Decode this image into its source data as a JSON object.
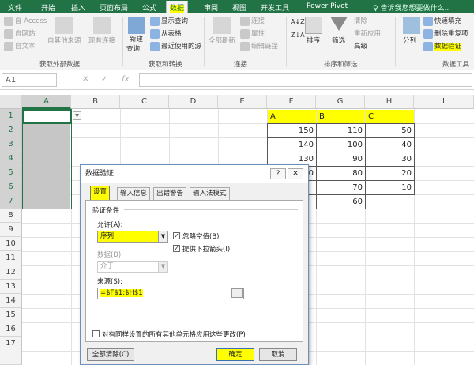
{
  "tabs": [
    "文件",
    "开始",
    "插入",
    "页面布局",
    "公式",
    "数据",
    "审阅",
    "视图",
    "开发工具",
    "Power Pivot"
  ],
  "tab_search": "♀ 告诉我您想要做什么...",
  "ribbon": {
    "external": {
      "access": "自 Access",
      "web": "自网站",
      "text": "自文本",
      "other": "自其他来源",
      "existing": "现有连接",
      "group": "获取外部数据"
    },
    "transform": {
      "new_query": "新建",
      "new_query2": "查询",
      "show_query": "显示查询",
      "from_table": "从表格",
      "recent": "最近使用的源",
      "group": "获取和转换"
    },
    "connections": {
      "refresh_all": "全部刷新",
      "conn": "连接",
      "props": "属性",
      "edit_links": "编辑链接",
      "group": "连接"
    },
    "sort": {
      "az": "A↓Z",
      "za": "Z↓A",
      "sort": "排序",
      "filter": "筛选",
      "clear": "清除",
      "reapply": "重新应用",
      "advanced": "高级",
      "group": "排序和筛选"
    },
    "tools": {
      "split": "分列",
      "flash": "快速填充",
      "remove_dup": "删除重复项",
      "validation": "数据验证",
      "group": "数据工具"
    }
  },
  "formula_bar": {
    "name_box": "A1",
    "cancel": "✕",
    "enter": "✓",
    "fx": "fx"
  },
  "columns": [
    "A",
    "B",
    "C",
    "D",
    "E",
    "F",
    "G",
    "H",
    "I"
  ],
  "rows": [
    "1",
    "2",
    "3",
    "4",
    "5",
    "6",
    "7",
    "8",
    "9",
    "10",
    "11",
    "12",
    "13",
    "14",
    "15",
    "16",
    "17"
  ],
  "cells": {
    "F1": "A",
    "G1": "B",
    "H1": "C",
    "F2": "150",
    "G2": "110",
    "H2": "50",
    "F3": "140",
    "G3": "100",
    "H3": "40",
    "F4": "130",
    "G4": "90",
    "H4": "30",
    "F5": "0",
    "G5": "80",
    "H5": "20",
    "G6": "70",
    "H6": "10",
    "G7": "60"
  },
  "colors": {
    "excel_green": "#217346",
    "highlight": "#ffff00",
    "selection": "#c6c6c6"
  },
  "dialog": {
    "title": "数据验证",
    "help": "?",
    "close": "✕",
    "tabs": [
      "设置",
      "输入信息",
      "出错警告",
      "输入法模式"
    ],
    "criteria": "验证条件",
    "allow_label": "允许(A):",
    "allow_value": "序列",
    "ignore_blank": "忽略空值(B)",
    "dropdown": "提供下拉箭头(I)",
    "data_label": "数据(D):",
    "data_value": "介于",
    "source_label": "来源(S):",
    "source_value": "=$F$1:$H$1",
    "apply_all": "对有同样设置的所有其他单元格应用这些更改(P)",
    "clear_all": "全部清除(C)",
    "ok": "确定",
    "cancel": "取消"
  }
}
